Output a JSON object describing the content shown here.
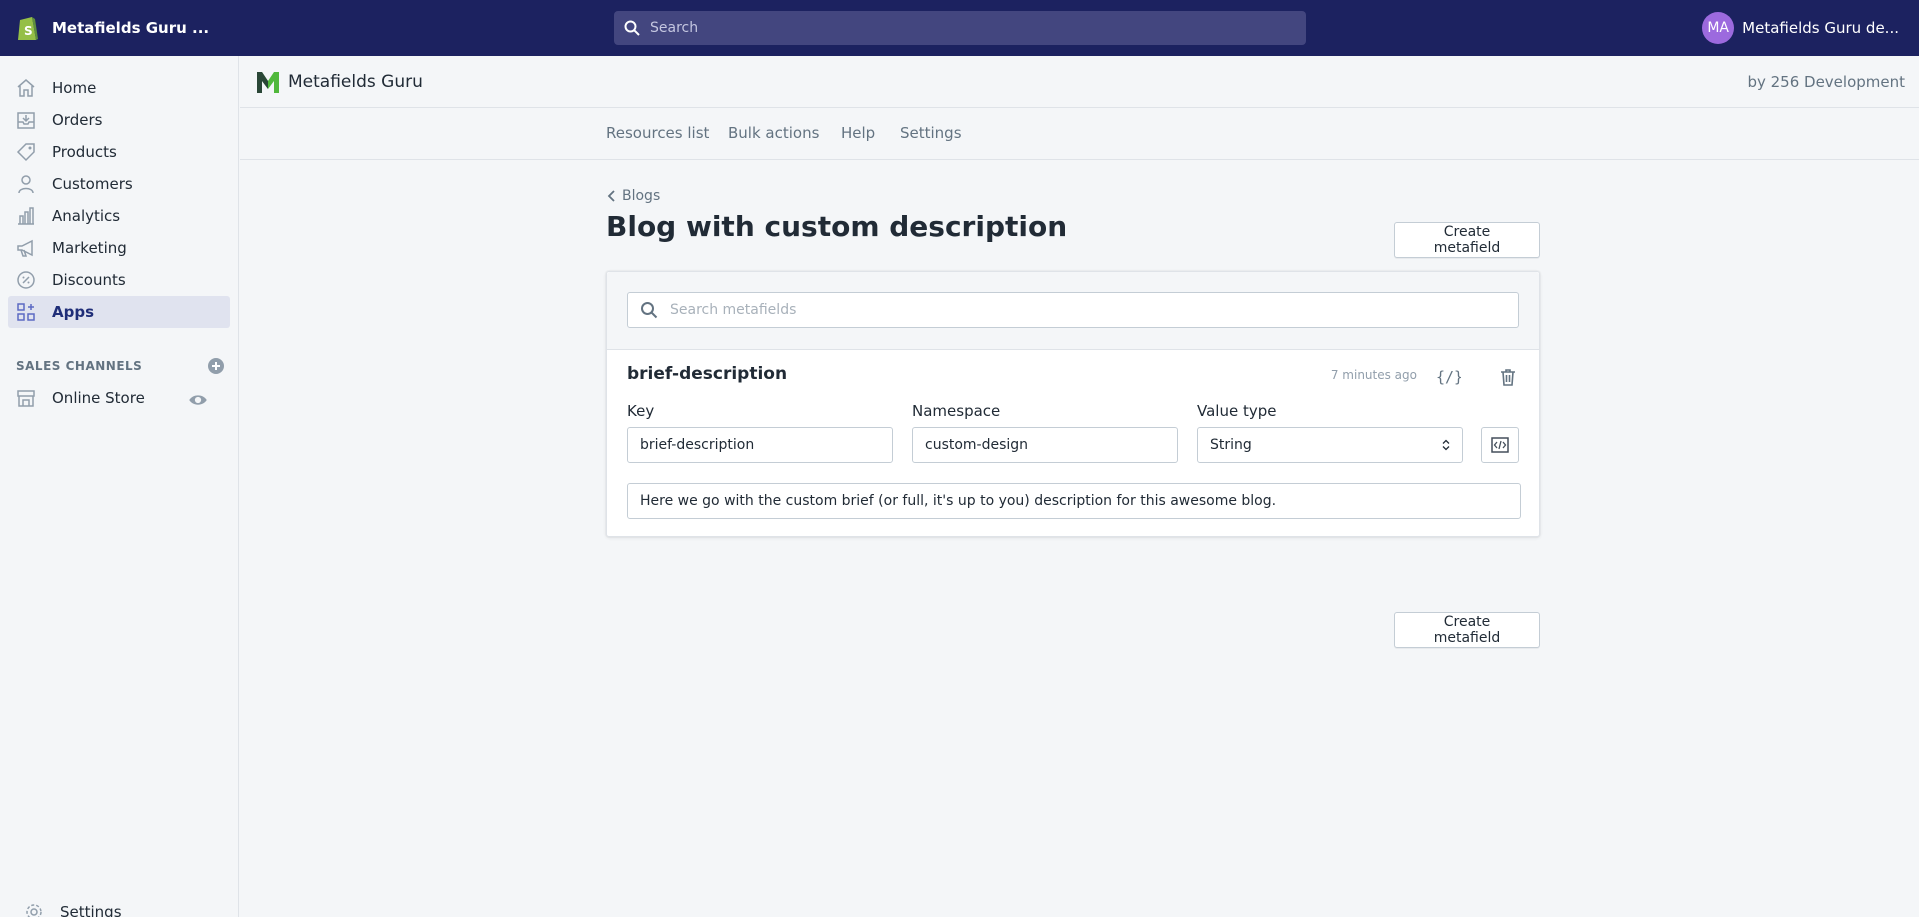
{
  "topbar": {
    "store_name": "Metafields Guru ...",
    "search_placeholder": "Search",
    "user_initials": "MA",
    "user_name": "Metafields Guru de..."
  },
  "sidebar": {
    "items": [
      {
        "label": "Home",
        "icon": "home-icon"
      },
      {
        "label": "Orders",
        "icon": "orders-icon"
      },
      {
        "label": "Products",
        "icon": "tag-icon"
      },
      {
        "label": "Customers",
        "icon": "customer-icon"
      },
      {
        "label": "Analytics",
        "icon": "analytics-icon"
      },
      {
        "label": "Marketing",
        "icon": "megaphone-icon"
      },
      {
        "label": "Discounts",
        "icon": "discount-icon"
      },
      {
        "label": "Apps",
        "icon": "apps-icon"
      }
    ],
    "sales_channels_heading": "SALES CHANNELS",
    "online_store": "Online Store",
    "settings": "Settings"
  },
  "app": {
    "name": "Metafields Guru",
    "by": "by 256 Development",
    "tabs": [
      "Resources list",
      "Bulk actions",
      "Help",
      "Settings"
    ]
  },
  "page": {
    "breadcrumb": "Blogs",
    "title": "Blog with custom description",
    "create_button": "Create metafield",
    "search_placeholder": "Search metafields"
  },
  "metafield": {
    "name": "brief-description",
    "updated": "7 minutes ago",
    "key_label": "Key",
    "key_value": "brief-description",
    "namespace_label": "Namespace",
    "namespace_value": "custom-design",
    "value_type_label": "Value type",
    "value_type": "String",
    "value": "Here we go with the custom brief (or full, it's up to you) description for this awesome blog."
  },
  "colors": {
    "topbar": "#1c2260",
    "active_nav": "#e0e3ef",
    "avatar": "#9c6ade"
  }
}
